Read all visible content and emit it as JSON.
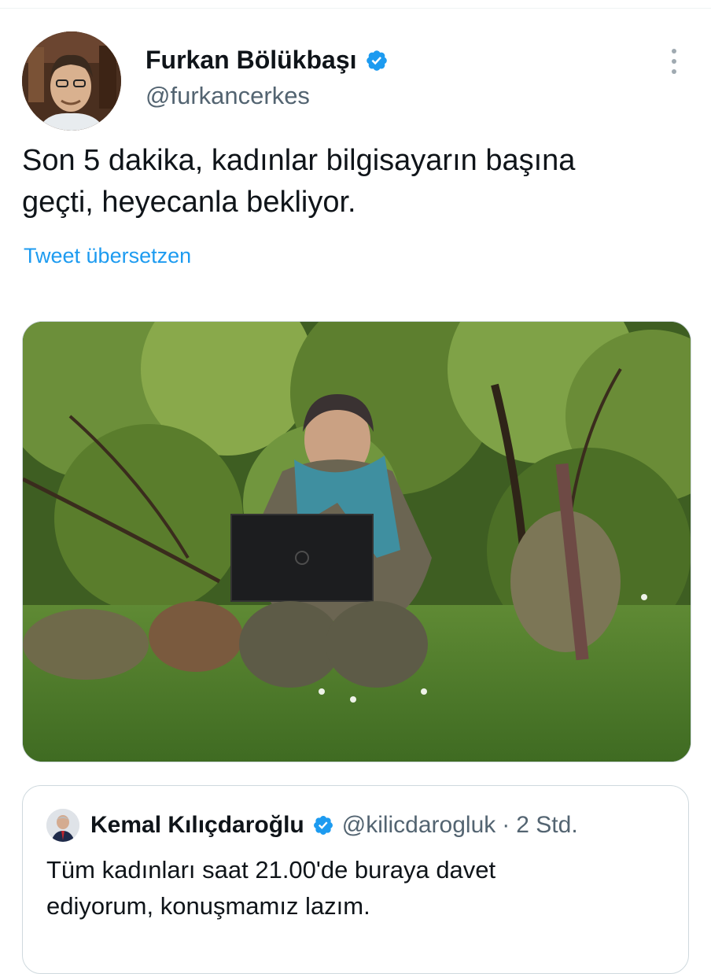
{
  "author": {
    "name": "Furkan Bölükbaşı",
    "handle": "@furkancerkes",
    "verified": true,
    "avatar_icon": "profile-photo"
  },
  "tweet": {
    "text_line1": "Son 5 dakika, kadınlar bilgisayarın başına",
    "text_line2": "geçti, heyecanla bekliyor.",
    "translate_label": "Tweet übersetzen"
  },
  "media": {
    "icon": "photo-woman-laptop-forest"
  },
  "quoted_tweet": {
    "name": "Kemal Kılıçdaroğlu",
    "handle": "@kilicdarogluk",
    "separator": "·",
    "time": "2 Std.",
    "verified": true,
    "text_line1": "Tüm kadınları saat 21.00'de buraya davet",
    "text_line2": "ediyorum, konuşmamız lazım."
  },
  "colors": {
    "link": "#1d9bf0",
    "verified": "#1d9bf0",
    "secondary_text": "#536471",
    "primary_text": "#0f1419",
    "border": "#cfd9de"
  }
}
